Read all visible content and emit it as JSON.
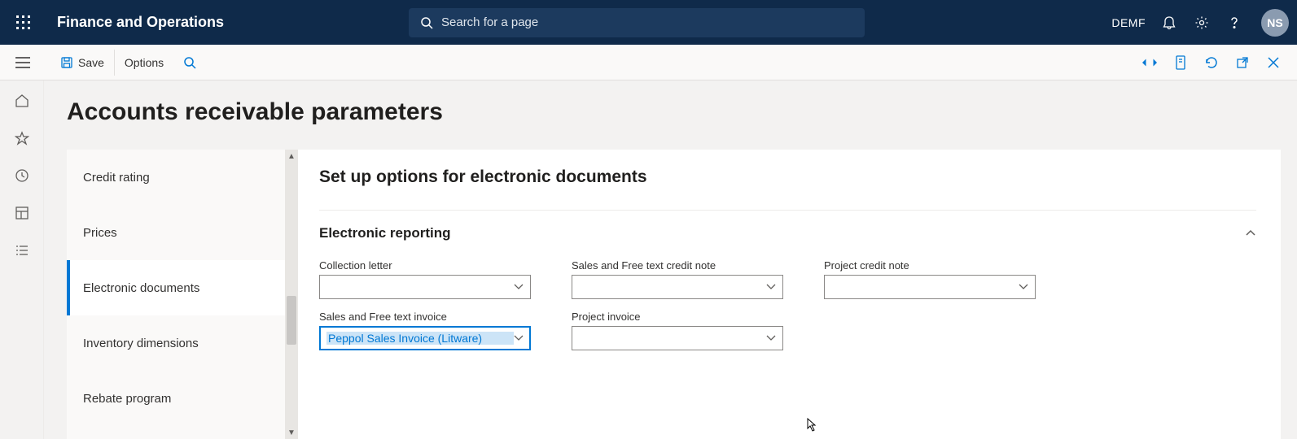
{
  "header": {
    "app_title": "Finance and Operations",
    "search_placeholder": "Search for a page",
    "company": "DEMF",
    "avatar_initials": "NS"
  },
  "actionbar": {
    "save_label": "Save",
    "options_label": "Options"
  },
  "page": {
    "title": "Accounts receivable parameters"
  },
  "sidebar": {
    "items": [
      {
        "label": "Credit rating"
      },
      {
        "label": "Prices"
      },
      {
        "label": "Electronic documents"
      },
      {
        "label": "Inventory dimensions"
      },
      {
        "label": "Rebate program"
      }
    ],
    "selected_index": 2
  },
  "content": {
    "section_title": "Set up options for electronic documents",
    "subsection_title": "Electronic reporting",
    "fields": {
      "collection_letter": {
        "label": "Collection letter",
        "value": ""
      },
      "sales_credit_note": {
        "label": "Sales and Free text credit note",
        "value": ""
      },
      "project_credit_note": {
        "label": "Project credit note",
        "value": ""
      },
      "sales_invoice": {
        "label": "Sales and Free text invoice",
        "value": "Peppol Sales Invoice (Litware)"
      },
      "project_invoice": {
        "label": "Project invoice",
        "value": ""
      }
    }
  }
}
